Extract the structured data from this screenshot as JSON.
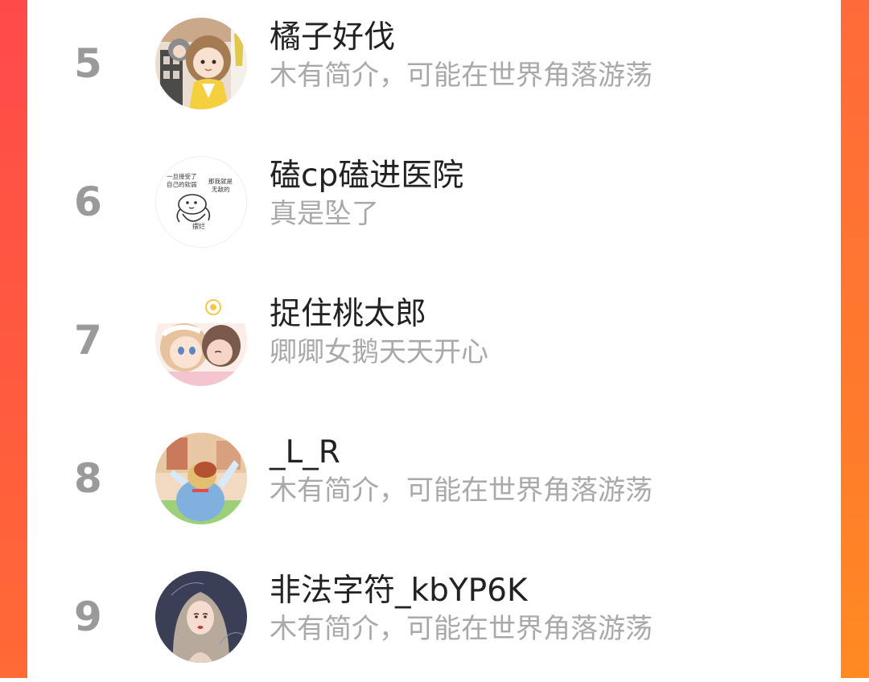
{
  "ranking": {
    "rows": [
      {
        "rank": "5",
        "name": "橘子好伐",
        "bio": "木有简介，可能在世界角落游荡",
        "avatar_icon": "anime-girl-avatar-icon"
      },
      {
        "rank": "6",
        "name": "磕cp磕进医院",
        "bio": "真是坠了",
        "avatar_icon": "meme-bear-avatar-icon",
        "avatar_text": [
          "一旦接受了",
          "自己的软弱",
          "那我就是",
          "无敌的",
          "摆烂"
        ]
      },
      {
        "rank": "7",
        "name": "捉住桃太郎",
        "bio": "卿卿女鹅天天开心",
        "avatar_icon": "anime-couple-avatar-icon"
      },
      {
        "rank": "8",
        "name": "_L_R",
        "bio": "木有简介，可能在世界角落游荡",
        "avatar_icon": "game-character-avatar-icon"
      },
      {
        "rank": "9",
        "name": "非法字符_kbYP6K",
        "bio": "木有简介，可能在世界角落游荡",
        "avatar_icon": "illustrated-woman-avatar-icon"
      }
    ]
  },
  "colors": {
    "rank": "#9a9a9a",
    "name": "#222222",
    "bio": "#a9a9a9",
    "edge_left": "#ff4a4a",
    "edge_right": "#ff7a2c"
  }
}
